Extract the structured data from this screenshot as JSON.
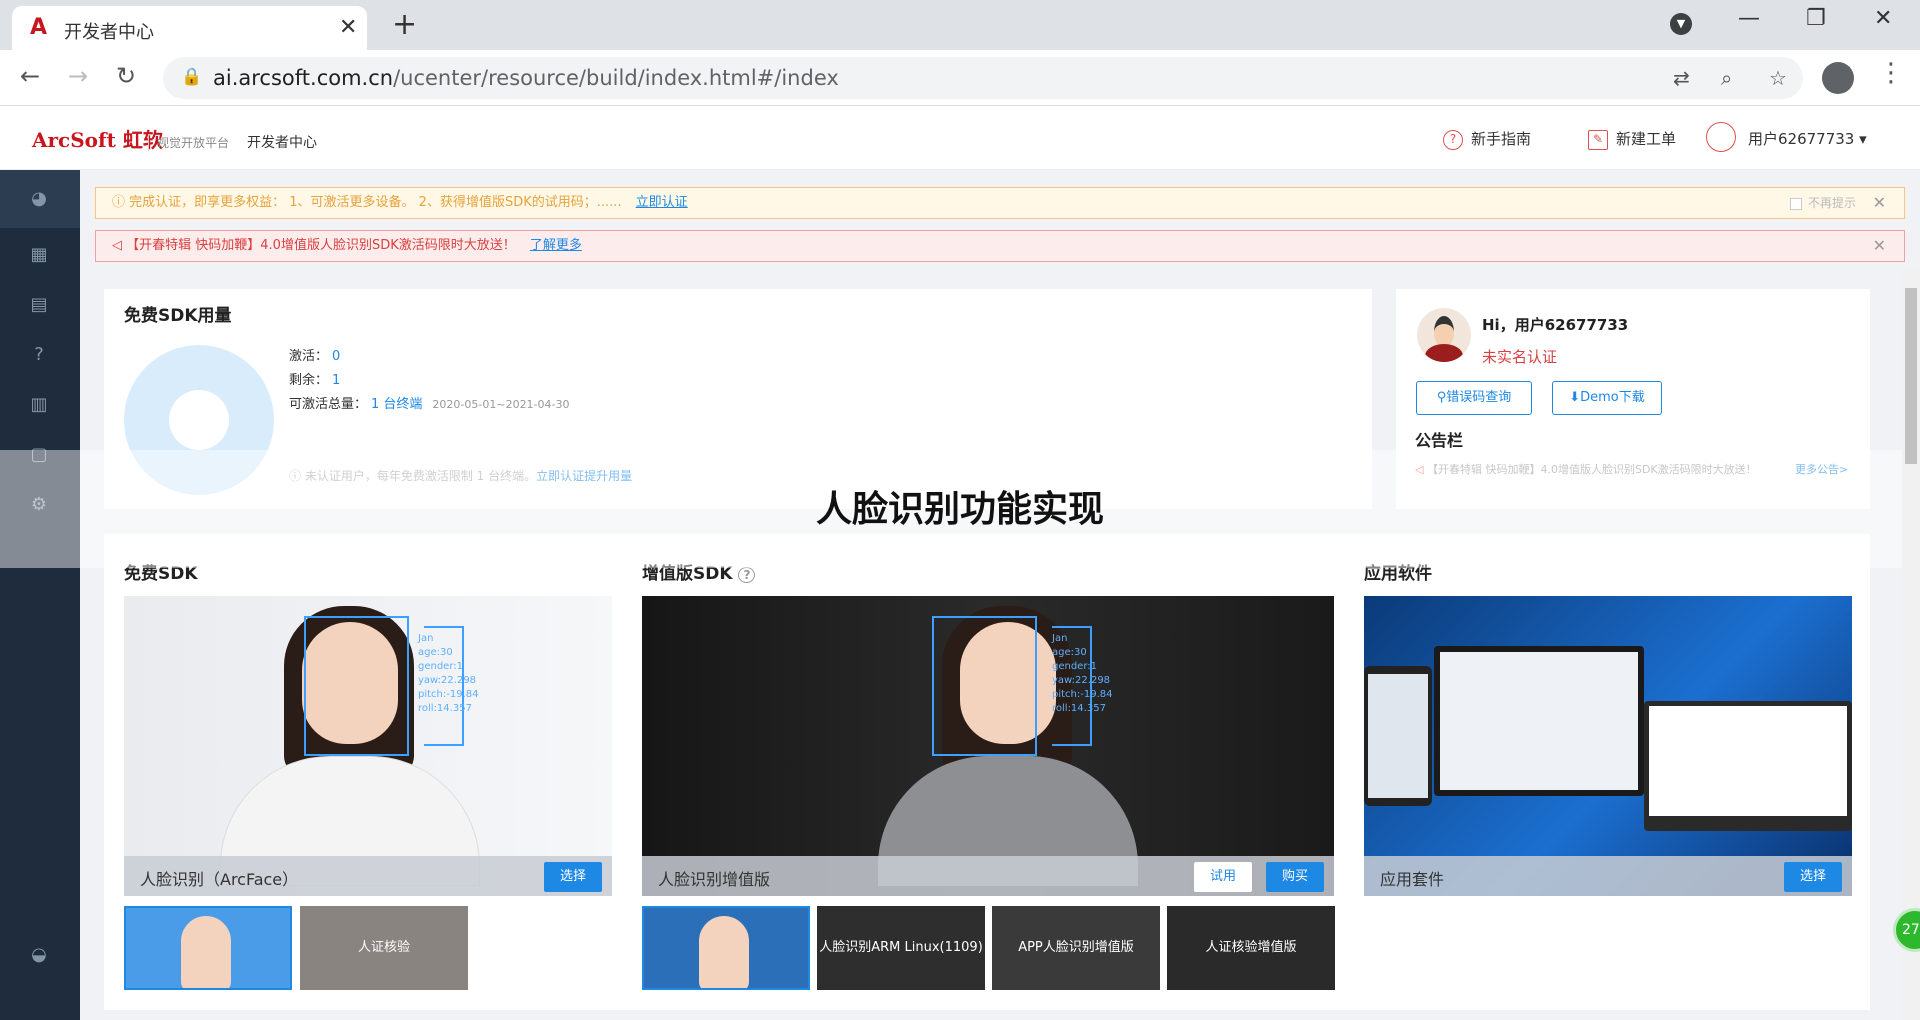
{
  "browser": {
    "tab_title": "开发者中心",
    "url_domain": "ai.arcsoft.com.cn",
    "url_path": "/ucenter/resource/build/index.html#/index"
  },
  "header": {
    "logo_text": "ArcSoft 虹软",
    "logo_sub": "视觉开放平台",
    "dev_center": "开发者中心",
    "guide": "新手指南",
    "ticket": "新建工单",
    "user": "用户62677733"
  },
  "alerts": {
    "warn_text": "完成认证，即享更多权益： 1、可激活更多设备。 2、获得增值版SDK的试用码；......",
    "warn_link": "立即认证",
    "warn_nomore": "不再提示",
    "err_text": "【开春特辑 快码加鞭】4.0增值版人脸识别SDK激活码限时大放送！",
    "err_link": "了解更多"
  },
  "usage": {
    "title": "免费SDK用量",
    "activated_label": "激活：",
    "activated_value": "0",
    "remaining_label": "剩余：",
    "remaining_value": "1",
    "total_label": "可激活总量：",
    "total_value": "1 台终端",
    "range": "2020-05-01~2021-04-30",
    "note": "未认证用户，每年免费激活限制 1 台终端。",
    "note_link": "立即认证提升用量"
  },
  "profile": {
    "greeting": "Hi，用户62677733",
    "state": "未实名认证",
    "btn_error": "错误码查询",
    "btn_demo": "Demo下载",
    "notice_title": "公告栏",
    "notice_item": "【开春特辑 快码加鞭】4.0增值版人脸识别SDK激活码限时大放送！",
    "notice_more": "更多公告>"
  },
  "overlay_title": "人脸识别功能实现",
  "sections": {
    "free": {
      "title": "免费SDK",
      "card_label": "人脸识别（ArcFace）",
      "select": "选择",
      "thumb2": "人证核验"
    },
    "pro": {
      "title": "增值版SDK",
      "card_label": "人脸识别增值版",
      "trial": "试用",
      "buy": "购买",
      "thumb2": "人脸识别ARM Linux(1109)",
      "thumb3": "APP人脸识别增值版",
      "thumb4": "人证核验增值版"
    },
    "apps": {
      "title": "应用软件",
      "card_label": "应用套件",
      "select": "选择"
    }
  },
  "scan_text": [
    "Jan",
    "age:30",
    "gender:1",
    "yaw:22.298",
    "pitch:-19.84",
    "roll:14.357"
  ],
  "fab_label": "27"
}
